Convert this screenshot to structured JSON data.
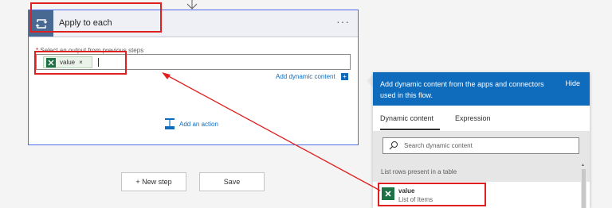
{
  "card": {
    "title": "Apply to each",
    "more": "···",
    "field_required": "* ",
    "field_label": "Select an output from previous steps",
    "token_label": "value",
    "token_remove": "×",
    "add_dynamic_link": "Add dynamic content",
    "add_dynamic_icon": "+",
    "add_action": "Add an action"
  },
  "buttons": {
    "new_step": "+ New step",
    "save": "Save"
  },
  "dynamic_panel": {
    "header_text": "Add dynamic content from the apps and connectors used in this flow.",
    "hide": "Hide",
    "tabs": [
      {
        "label": "Dynamic content",
        "active": true
      },
      {
        "label": "Expression",
        "active": false
      }
    ],
    "search_placeholder": "Search dynamic content",
    "section_label": "List rows present in a table",
    "items": [
      {
        "name": "value",
        "description": "List of Items",
        "icon": "excel-icon"
      }
    ]
  },
  "colors": {
    "accent": "#0f6cbd",
    "loop_header": "#486991",
    "excel": "#1e7145",
    "annotation": "#e02020"
  }
}
